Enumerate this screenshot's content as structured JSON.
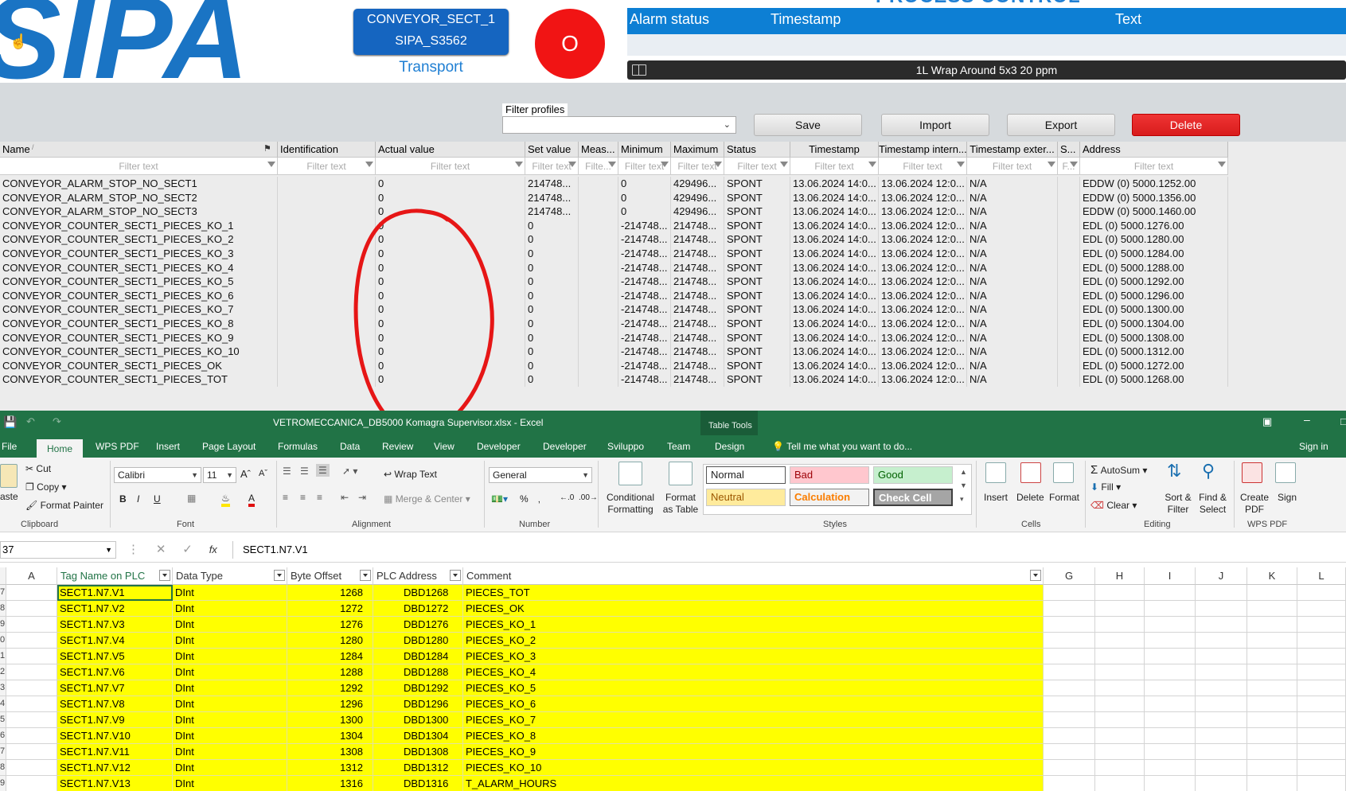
{
  "scada": {
    "logo_text": "SIPA",
    "process_title": "PROCESS CONTROL",
    "tag": {
      "line1": "CONVEYOR_SECT_1",
      "line2": "SIPA_S3562",
      "caption": "Transport"
    },
    "status_button_label": "O",
    "alarm_table": {
      "headers": [
        "Alarm status",
        "Timestamp",
        "Text"
      ]
    },
    "recipe": "1L Wrap Around 5x3 20 ppm",
    "filter_profiles_label": "Filter profiles",
    "filter_profiles_value": "",
    "buttons": {
      "save": "Save",
      "import": "Import",
      "export": "Export",
      "delete": "Delete"
    },
    "filter_placeholder": "Filter text",
    "grid_headers": [
      "Name",
      "Identification",
      "Actual value",
      "Set value",
      "Meas...",
      "Minimum",
      "Maximum",
      "Status",
      "Timestamp",
      "Timestamp intern...",
      "Timestamp exter...",
      "S...",
      "Address"
    ],
    "grid_filter_texts": [
      "Filter text",
      "Filter text",
      "Filter text",
      "Filter text",
      "Filte...",
      "Filter text",
      "Filter text",
      "Filter text",
      "Filter text",
      "Filter text",
      "Filter text",
      "F...",
      "Filter text"
    ],
    "grid_rows": [
      [
        "CONVEYOR_ALARM_STOP_NO_SECT1",
        "",
        "0",
        "214748...",
        "",
        "0",
        "429496...",
        "SPONT",
        "13.06.2024 14:0...",
        "13.06.2024 12:0...",
        "N/A",
        "",
        "EDDW (0) 5000.1252.00"
      ],
      [
        "CONVEYOR_ALARM_STOP_NO_SECT2",
        "",
        "0",
        "214748...",
        "",
        "0",
        "429496...",
        "SPONT",
        "13.06.2024 14:0...",
        "13.06.2024 12:0...",
        "N/A",
        "",
        "EDDW (0) 5000.1356.00"
      ],
      [
        "CONVEYOR_ALARM_STOP_NO_SECT3",
        "",
        "0",
        "214748...",
        "",
        "0",
        "429496...",
        "SPONT",
        "13.06.2024 14:0...",
        "13.06.2024 12:0...",
        "N/A",
        "",
        "EDDW (0) 5000.1460.00"
      ],
      [
        "CONVEYOR_COUNTER_SECT1_PIECES_KO_1",
        "",
        "0",
        "0",
        "",
        "-214748...",
        "214748...",
        "SPONT",
        "13.06.2024 14:0...",
        "13.06.2024 12:0...",
        "N/A",
        "",
        "EDL (0) 5000.1276.00"
      ],
      [
        "CONVEYOR_COUNTER_SECT1_PIECES_KO_2",
        "",
        "0",
        "0",
        "",
        "-214748...",
        "214748...",
        "SPONT",
        "13.06.2024 14:0...",
        "13.06.2024 12:0...",
        "N/A",
        "",
        "EDL (0) 5000.1280.00"
      ],
      [
        "CONVEYOR_COUNTER_SECT1_PIECES_KO_3",
        "",
        "0",
        "0",
        "",
        "-214748...",
        "214748...",
        "SPONT",
        "13.06.2024 14:0...",
        "13.06.2024 12:0...",
        "N/A",
        "",
        "EDL (0) 5000.1284.00"
      ],
      [
        "CONVEYOR_COUNTER_SECT1_PIECES_KO_4",
        "",
        "0",
        "0",
        "",
        "-214748...",
        "214748...",
        "SPONT",
        "13.06.2024 14:0...",
        "13.06.2024 12:0...",
        "N/A",
        "",
        "EDL (0) 5000.1288.00"
      ],
      [
        "CONVEYOR_COUNTER_SECT1_PIECES_KO_5",
        "",
        "0",
        "0",
        "",
        "-214748...",
        "214748...",
        "SPONT",
        "13.06.2024 14:0...",
        "13.06.2024 12:0...",
        "N/A",
        "",
        "EDL (0) 5000.1292.00"
      ],
      [
        "CONVEYOR_COUNTER_SECT1_PIECES_KO_6",
        "",
        "0",
        "0",
        "",
        "-214748...",
        "214748...",
        "SPONT",
        "13.06.2024 14:0...",
        "13.06.2024 12:0...",
        "N/A",
        "",
        "EDL (0) 5000.1296.00"
      ],
      [
        "CONVEYOR_COUNTER_SECT1_PIECES_KO_7",
        "",
        "0",
        "0",
        "",
        "-214748...",
        "214748...",
        "SPONT",
        "13.06.2024 14:0...",
        "13.06.2024 12:0...",
        "N/A",
        "",
        "EDL (0) 5000.1300.00"
      ],
      [
        "CONVEYOR_COUNTER_SECT1_PIECES_KO_8",
        "",
        "0",
        "0",
        "",
        "-214748...",
        "214748...",
        "SPONT",
        "13.06.2024 14:0...",
        "13.06.2024 12:0...",
        "N/A",
        "",
        "EDL (0) 5000.1304.00"
      ],
      [
        "CONVEYOR_COUNTER_SECT1_PIECES_KO_9",
        "",
        "0",
        "0",
        "",
        "-214748...",
        "214748...",
        "SPONT",
        "13.06.2024 14:0...",
        "13.06.2024 12:0...",
        "N/A",
        "",
        "EDL (0) 5000.1308.00"
      ],
      [
        "CONVEYOR_COUNTER_SECT1_PIECES_KO_10",
        "",
        "0",
        "0",
        "",
        "-214748...",
        "214748...",
        "SPONT",
        "13.06.2024 14:0...",
        "13.06.2024 12:0...",
        "N/A",
        "",
        "EDL (0) 5000.1312.00"
      ],
      [
        "CONVEYOR_COUNTER_SECT1_PIECES_OK",
        "",
        "0",
        "0",
        "",
        "-214748...",
        "214748...",
        "SPONT",
        "13.06.2024 14:0...",
        "13.06.2024 12:0...",
        "N/A",
        "",
        "EDL (0) 5000.1272.00"
      ],
      [
        "CONVEYOR_COUNTER_SECT1_PIECES_TOT",
        "",
        "0",
        "0",
        "",
        "-214748...",
        "214748...",
        "SPONT",
        "13.06.2024 14:0...",
        "13.06.2024 12:0...",
        "N/A",
        "",
        "EDL (0) 5000.1268.00"
      ]
    ]
  },
  "excel": {
    "title": "VETROMECCANICA_DB5000 Komagra Supervisor.xlsx - Excel",
    "table_tools": "Table Tools",
    "tabs": [
      "File",
      "Home",
      "WPS PDF",
      "Insert",
      "Page Layout",
      "Formulas",
      "Data",
      "Review",
      "View",
      "Developer",
      "Developer",
      "Sviluppo",
      "Team",
      "Design"
    ],
    "tell_me": "Tell me what you want to do...",
    "sign_in": "Sign in",
    "clipboard": {
      "paste": "aste",
      "cut": "Cut",
      "copy": "Copy",
      "format_painter": "Format Painter",
      "group": "Clipboard"
    },
    "font": {
      "name": "Calibri",
      "size": "11",
      "group": "Font"
    },
    "alignment": {
      "wrap": "Wrap Text",
      "merge": "Merge & Center",
      "group": "Alignment"
    },
    "number": {
      "format": "General",
      "group": "Number"
    },
    "styles": {
      "conditional": "Conditional Formatting",
      "format_table": "Format as Table",
      "normal": "Normal",
      "bad": "Bad",
      "good": "Good",
      "neutral": "Neutral",
      "calculation": "Calculation",
      "check_cell": "Check Cell",
      "group": "Styles"
    },
    "cells": {
      "insert": "Insert",
      "delete": "Delete",
      "format": "Format",
      "group": "Cells"
    },
    "editing": {
      "autosum": "AutoSum",
      "fill": "Fill",
      "clear": "Clear",
      "sort": "Sort & Filter",
      "find": "Find & Select",
      "group": "Editing"
    },
    "wpspdf": {
      "create": "Create PDF",
      "sign": "Sign",
      "group": "WPS PDF"
    },
    "name_box": "37",
    "formula": "SECT1.N7.V1",
    "columns": [
      "A",
      "Tag Name on PLC",
      "Data Type",
      "Byte Offset",
      "PLC Address",
      "Comment",
      "G",
      "H",
      "I",
      "J",
      "K",
      "L"
    ],
    "row_numbers": [
      "7",
      "8",
      "9",
      "0",
      "1",
      "2",
      "3",
      "4",
      "5",
      "6",
      "7",
      "8",
      "9"
    ],
    "rows": [
      [
        "SECT1.N7.V1",
        "DInt",
        "1268",
        "DBD1268",
        "PIECES_TOT"
      ],
      [
        "SECT1.N7.V2",
        "DInt",
        "1272",
        "DBD1272",
        "PIECES_OK"
      ],
      [
        "SECT1.N7.V3",
        "DInt",
        "1276",
        "DBD1276",
        "PIECES_KO_1"
      ],
      [
        "SECT1.N7.V4",
        "DInt",
        "1280",
        "DBD1280",
        "PIECES_KO_2"
      ],
      [
        "SECT1.N7.V5",
        "DInt",
        "1284",
        "DBD1284",
        "PIECES_KO_3"
      ],
      [
        "SECT1.N7.V6",
        "DInt",
        "1288",
        "DBD1288",
        "PIECES_KO_4"
      ],
      [
        "SECT1.N7.V7",
        "DInt",
        "1292",
        "DBD1292",
        "PIECES_KO_5"
      ],
      [
        "SECT1.N7.V8",
        "DInt",
        "1296",
        "DBD1296",
        "PIECES_KO_6"
      ],
      [
        "SECT1.N7.V9",
        "DInt",
        "1300",
        "DBD1300",
        "PIECES_KO_7"
      ],
      [
        "SECT1.N7.V10",
        "DInt",
        "1304",
        "DBD1304",
        "PIECES_KO_8"
      ],
      [
        "SECT1.N7.V11",
        "DInt",
        "1308",
        "DBD1308",
        "PIECES_KO_9"
      ],
      [
        "SECT1.N7.V12",
        "DInt",
        "1312",
        "DBD1312",
        "PIECES_KO_10"
      ],
      [
        "SECT1.N7.V13",
        "DInt",
        "1316",
        "DBD1316",
        "T_ALARM_HOURS"
      ]
    ]
  },
  "colors": {
    "sipa_blue": "#0d7fd4",
    "excel_green": "#217346",
    "delete_red": "#e02424",
    "highlight_yellow": "#ffff00"
  }
}
